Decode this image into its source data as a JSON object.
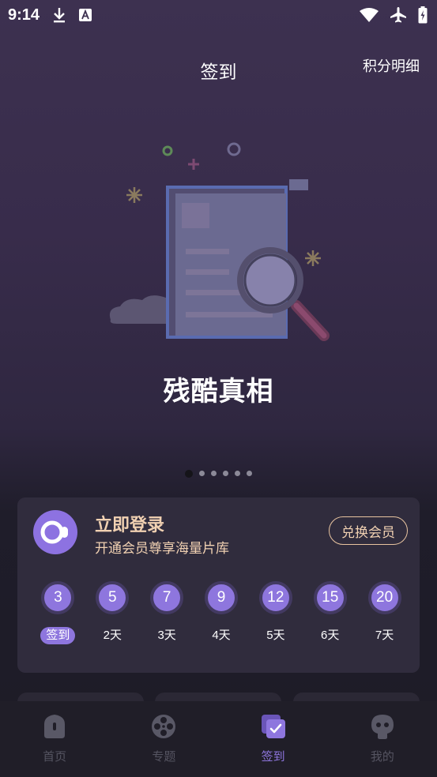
{
  "status_bar": {
    "time": "9:14",
    "icons": [
      "download-icon",
      "font-app-icon",
      "wifi-icon",
      "airplane-icon",
      "battery-icon"
    ]
  },
  "header": {
    "title": "签到",
    "points_detail": "积分明细"
  },
  "banner": {
    "title": "残酷真相",
    "page_count": 6,
    "active_page": 1
  },
  "signin_card": {
    "title": "立即登录",
    "subtitle": "开通会员尊享海量片库",
    "redeem_button": "兑换会员",
    "days": [
      {
        "points": "3",
        "label": "签到"
      },
      {
        "points": "5",
        "label": "2天"
      },
      {
        "points": "7",
        "label": "3天"
      },
      {
        "points": "9",
        "label": "4天"
      },
      {
        "points": "12",
        "label": "5天"
      },
      {
        "points": "15",
        "label": "6天"
      },
      {
        "points": "20",
        "label": "7天"
      }
    ]
  },
  "tabbar": {
    "tabs": [
      {
        "label": "首页",
        "icon": "home-icon",
        "active": false
      },
      {
        "label": "专题",
        "icon": "film-reel-icon",
        "active": false
      },
      {
        "label": "签到",
        "icon": "checkin-icon",
        "active": true
      },
      {
        "label": "我的",
        "icon": "profile-icon",
        "active": false
      }
    ]
  },
  "colors": {
    "accent": "#8e76de",
    "gold_text": "#f1d1b2",
    "card_bg": "#302c3d",
    "tabbar_bg": "#201e28"
  }
}
